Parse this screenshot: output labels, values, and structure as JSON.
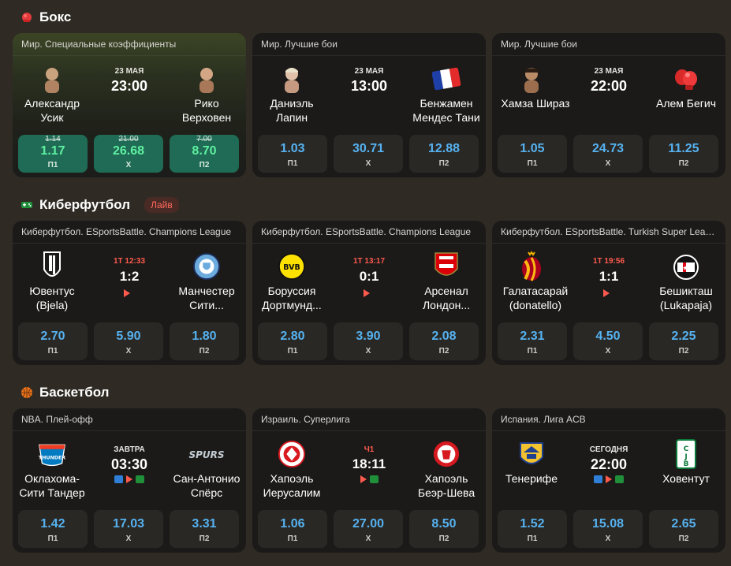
{
  "sections": [
    {
      "title": "Бокс",
      "icon": "boxing-glove-icon",
      "cards": [
        {
          "league": "Мир. Специальные коэффициенты",
          "highlighted": true,
          "home": {
            "name_l1": "Александр",
            "name_l2": "Усик",
            "logo": "fighter-photo"
          },
          "away": {
            "name_l1": "Рико",
            "name_l2": "Верховен",
            "logo": "fighter-photo"
          },
          "date": "23 МАЯ",
          "time": "23:00",
          "odds": [
            {
              "old": "1.14",
              "value": "1.17",
              "label": "П1"
            },
            {
              "old": "21.00",
              "value": "26.68",
              "label": "Х"
            },
            {
              "old": "7.00",
              "value": "8.70",
              "label": "П2"
            }
          ]
        },
        {
          "league": "Мир. Лучшие бои",
          "home": {
            "name_l1": "Даниэль",
            "name_l2": "Лапин",
            "logo": "fighter-photo"
          },
          "away": {
            "name_l1": "Бенжамен",
            "name_l2": "Мендес Тани",
            "logo": "france-flag-icon"
          },
          "date": "23 МАЯ",
          "time": "13:00",
          "odds": [
            {
              "value": "1.03",
              "label": "П1"
            },
            {
              "value": "30.71",
              "label": "Х"
            },
            {
              "value": "12.88",
              "label": "П2"
            }
          ]
        },
        {
          "league": "Мир. Лучшие бои",
          "home": {
            "name_l1": "Хамза Шираз",
            "name_l2": "",
            "logo": "fighter-photo"
          },
          "away": {
            "name_l1": "Алем Бегич",
            "name_l2": "",
            "logo": "boxing-glove-icon"
          },
          "date": "23 МАЯ",
          "time": "22:00",
          "odds": [
            {
              "value": "1.05",
              "label": "П1"
            },
            {
              "value": "24.73",
              "label": "Х"
            },
            {
              "value": "11.25",
              "label": "П2"
            }
          ]
        }
      ]
    },
    {
      "title": "Киберфутбол",
      "icon": "gamepad-icon",
      "badge": "Лайв",
      "cards": [
        {
          "league": "Киберфутбол. ESportsBattle. Champions League",
          "home": {
            "name_l1": "Ювентус",
            "name_l2": "(Bjela)",
            "logo": "juventus-logo"
          },
          "away": {
            "name_l1": "Манчестер",
            "name_l2": "Сити...",
            "logo": "man-city-logo"
          },
          "period": "1Т 12:33",
          "score": "1:2",
          "odds": [
            {
              "value": "2.70",
              "label": "П1"
            },
            {
              "value": "5.90",
              "label": "Х"
            },
            {
              "value": "1.80",
              "label": "П2"
            }
          ]
        },
        {
          "league": "Киберфутбол. ESportsBattle. Champions League",
          "home": {
            "name_l1": "Боруссия",
            "name_l2": "Дортмунд...",
            "logo": "bvb-logo"
          },
          "away": {
            "name_l1": "Арсенал",
            "name_l2": "Лондон...",
            "logo": "arsenal-logo"
          },
          "period": "1Т 13:17",
          "score": "0:1",
          "odds": [
            {
              "value": "2.80",
              "label": "П1"
            },
            {
              "value": "3.90",
              "label": "Х"
            },
            {
              "value": "2.08",
              "label": "П2"
            }
          ]
        },
        {
          "league": "Киберфутбол. ESportsBattle. Turkish Super League",
          "home": {
            "name_l1": "Галатасарай",
            "name_l2": "(donatello)",
            "logo": "galatasaray-logo"
          },
          "away": {
            "name_l1": "Бешикташ",
            "name_l2": "(Lukapaja)",
            "logo": "besiktas-logo"
          },
          "period": "1Т 19:56",
          "score": "1:1",
          "odds": [
            {
              "value": "2.31",
              "label": "П1"
            },
            {
              "value": "4.50",
              "label": "Х"
            },
            {
              "value": "2.25",
              "label": "П2"
            }
          ]
        }
      ]
    },
    {
      "title": "Баскетбол",
      "icon": "basketball-icon",
      "cards": [
        {
          "league": "NBA. Плей-офф",
          "home": {
            "name_l1": "Оклахома-",
            "name_l2": "Сити Тандер",
            "logo": "okc-logo"
          },
          "away": {
            "name_l1": "Сан-Антонио",
            "name_l2": "Спёрс",
            "logo": "spurs-logo"
          },
          "date": "ЗАВТРА",
          "time": "03:30",
          "odds": [
            {
              "value": "1.42",
              "label": "П1"
            },
            {
              "value": "17.03",
              "label": "Х"
            },
            {
              "value": "3.31",
              "label": "П2"
            }
          ]
        },
        {
          "league": "Израиль. Суперлига",
          "home": {
            "name_l1": "Хапоэль",
            "name_l2": "Иерусалим",
            "logo": "hapoel-jerusalem-logo"
          },
          "away": {
            "name_l1": "Хапоэль",
            "name_l2": "Беэр-Шева",
            "logo": "hapoel-beersheva-logo"
          },
          "period": "Ч1",
          "score": "18:11",
          "odds": [
            {
              "value": "1.06",
              "label": "П1"
            },
            {
              "value": "27.00",
              "label": "Х"
            },
            {
              "value": "8.50",
              "label": "П2"
            }
          ]
        },
        {
          "league": "Испания. Лига ACB",
          "home": {
            "name_l1": "Тенерифе",
            "name_l2": "",
            "logo": "tenerife-logo"
          },
          "away": {
            "name_l1": "Ховентут",
            "name_l2": "",
            "logo": "joventut-logo"
          },
          "date": "СЕГОДНЯ",
          "time": "22:00",
          "odds": [
            {
              "value": "1.52",
              "label": "П1"
            },
            {
              "value": "15.08",
              "label": "Х"
            },
            {
              "value": "2.65",
              "label": "П2"
            }
          ]
        }
      ]
    }
  ],
  "colors": {
    "background": "#2f2b24",
    "card": "#1b1a19",
    "odd_button": "#2a2825",
    "odd_value": "#55b2f0",
    "live_red": "#ff5a4d",
    "boosted_green": "#1f6b55"
  }
}
